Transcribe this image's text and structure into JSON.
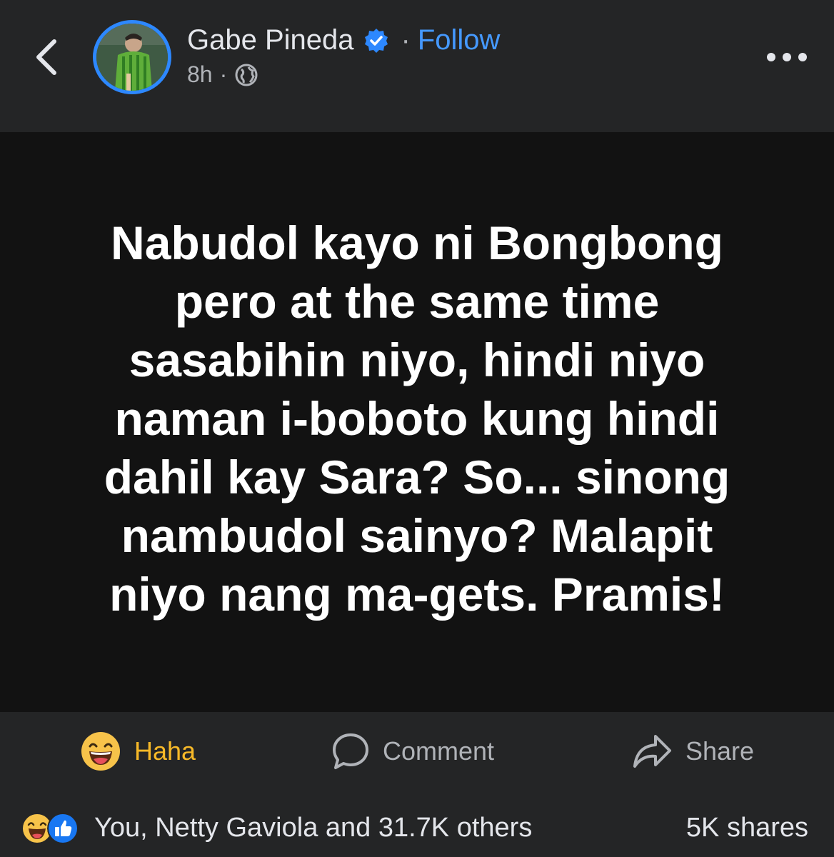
{
  "header": {
    "author_name": "Gabe Pineda",
    "separator": "·",
    "follow_label": "Follow",
    "timestamp": "8h",
    "meta_separator": "·",
    "icons": {
      "back": "chevron-left-icon",
      "verified": "verified-badge-icon",
      "audience": "globe-icon",
      "more": "more-options-icon"
    }
  },
  "post": {
    "text": "Nabudol kayo ni Bongbong pero at the same time sasabihin niyo, hindi niyo naman i-boboto kung hindi dahil kay Sara? So... sinong nambudol sainyo? Malapit niyo nang ma-gets. Pramis!",
    "background_color": "#121212"
  },
  "actions": {
    "react_label": "Haha",
    "comment_label": "Comment",
    "share_label": "Share"
  },
  "footer": {
    "reaction_summary": "You, Netty Gaviola and 31.7K others",
    "shares_count": "5K shares"
  },
  "colors": {
    "accent_blue": "#4599ff",
    "haha_yellow": "#f7b928",
    "surface": "#242526"
  }
}
